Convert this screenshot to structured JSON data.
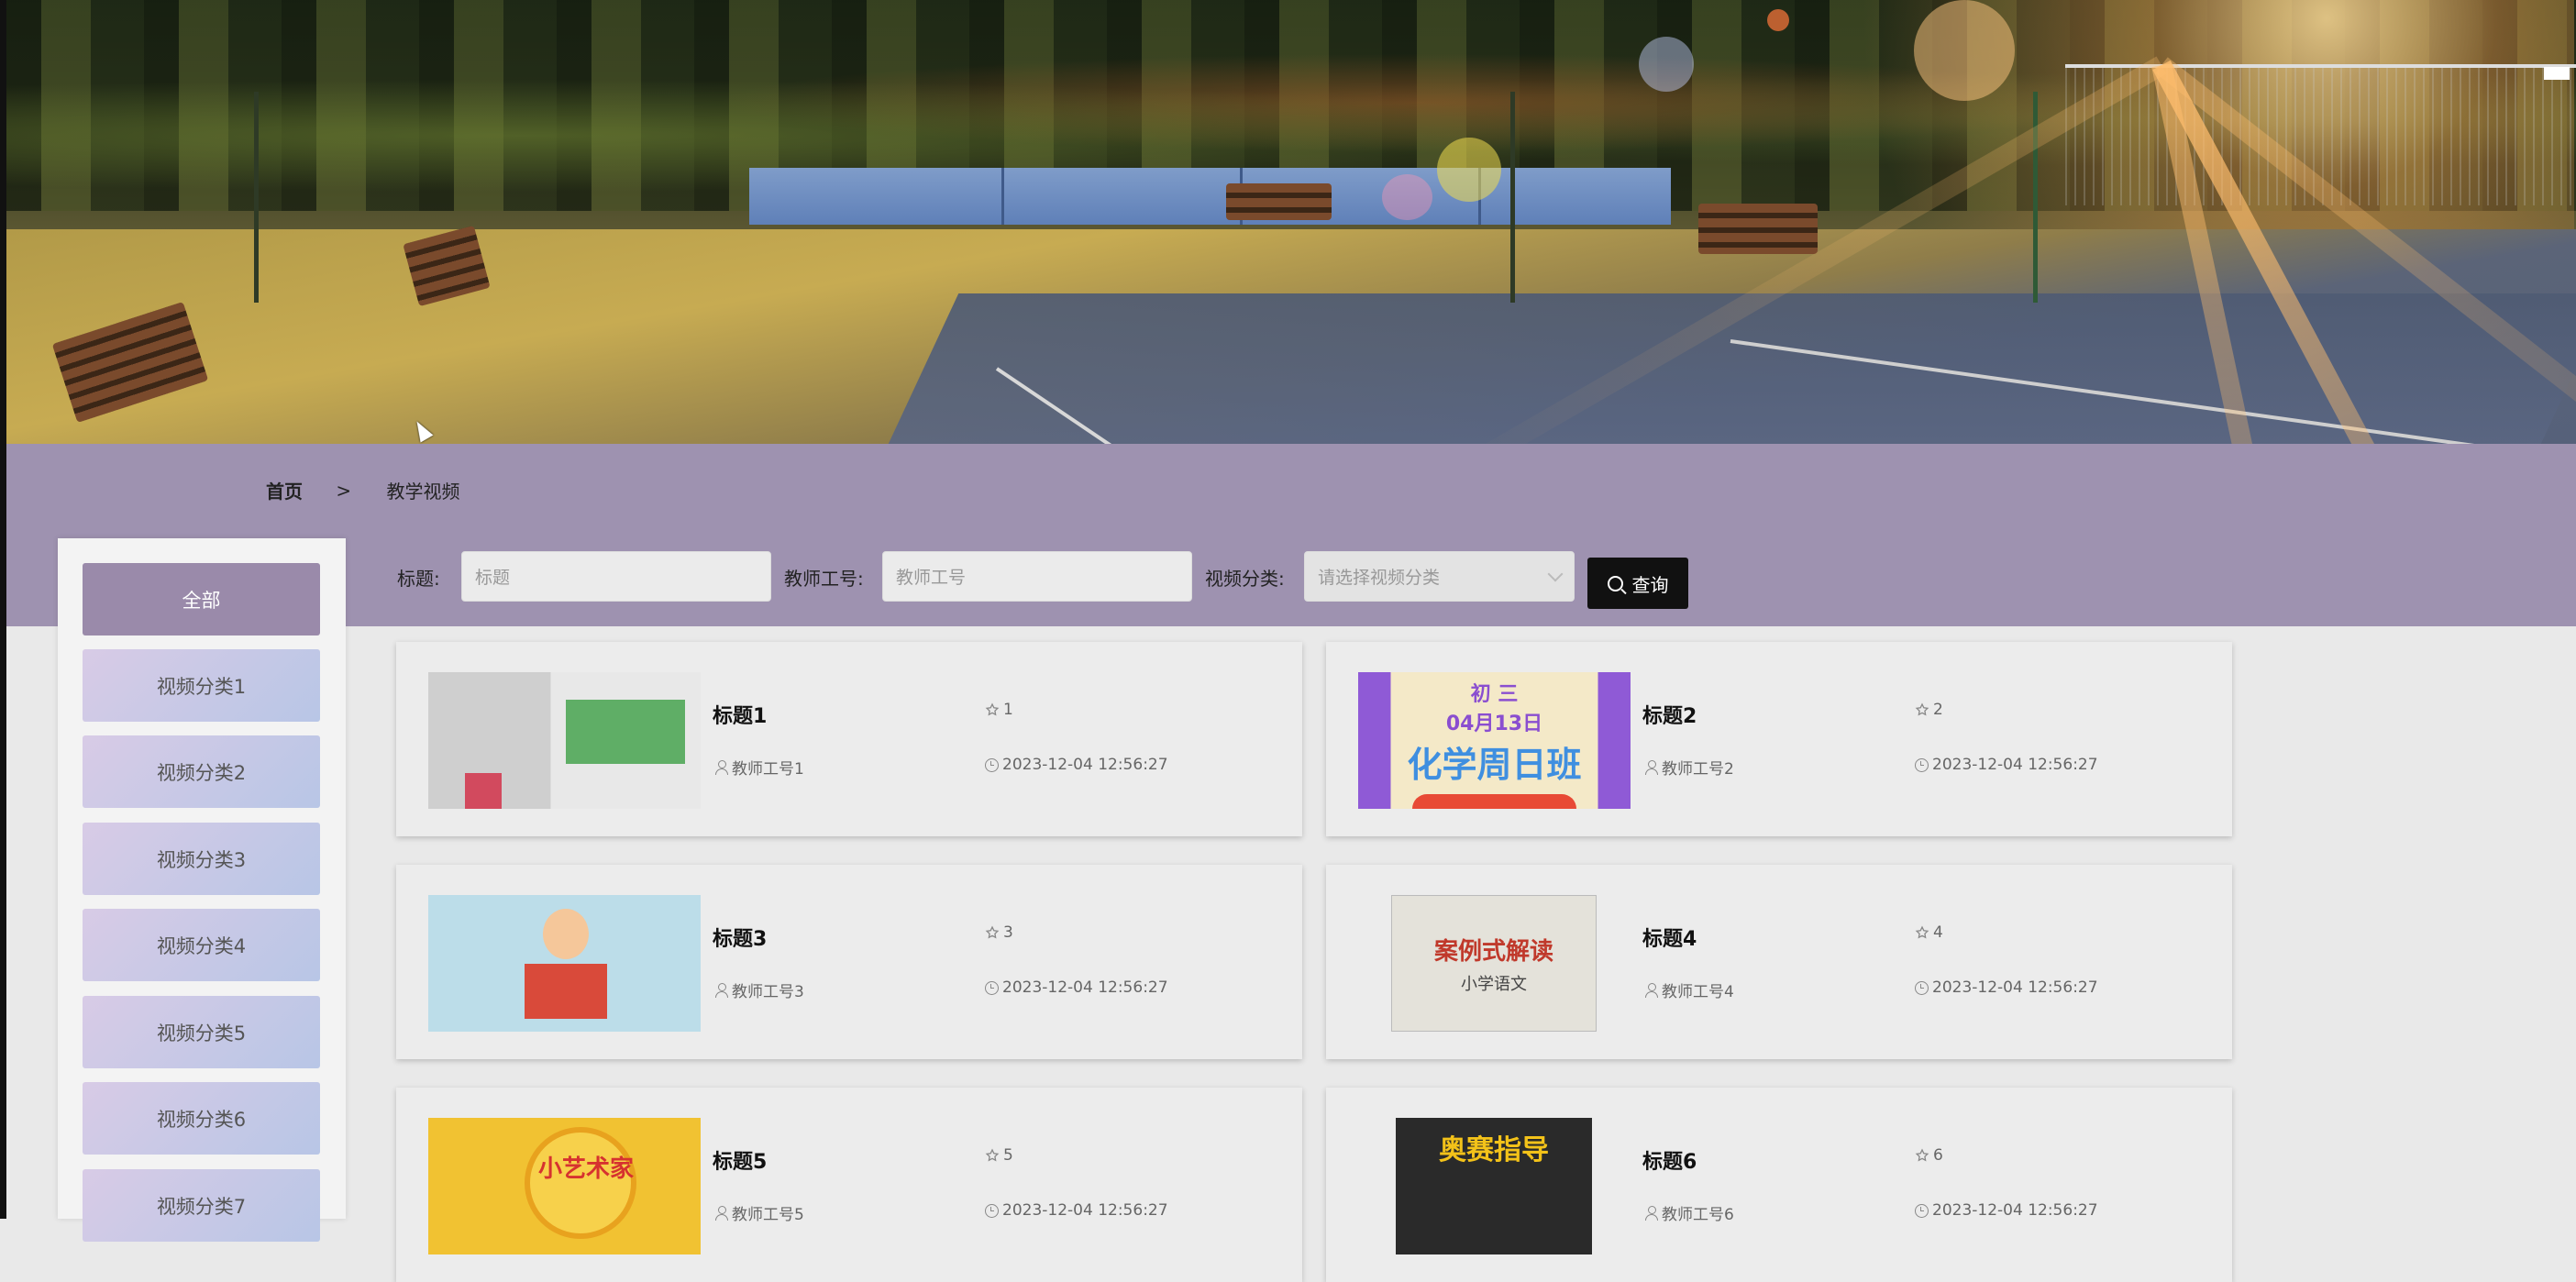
{
  "breadcrumb": {
    "home": "首页",
    "separator": ">",
    "current": "教学视频"
  },
  "sidebar": {
    "items": [
      {
        "label": "全部",
        "active": true
      },
      {
        "label": "视频分类1"
      },
      {
        "label": "视频分类2"
      },
      {
        "label": "视频分类3"
      },
      {
        "label": "视频分类4"
      },
      {
        "label": "视频分类5"
      },
      {
        "label": "视频分类6"
      },
      {
        "label": "视频分类7"
      }
    ]
  },
  "search": {
    "title_label": "标题:",
    "title_placeholder": "标题",
    "teacher_label": "教师工号:",
    "teacher_placeholder": "教师工号",
    "category_label": "视频分类:",
    "category_placeholder": "请选择视频分类",
    "button_label": "查询"
  },
  "cards": [
    {
      "title": "标题1",
      "favorites": "1",
      "teacher": "教师工号1",
      "time": "2023-12-04 12:56:27",
      "thumb": "book-cover-icon"
    },
    {
      "title": "标题2",
      "favorites": "2",
      "teacher": "教师工号2",
      "time": "2023-12-04 12:56:27",
      "thumb": "poster-icon",
      "thumb_text_top": "初 三",
      "thumb_text_date": "04月13日",
      "thumb_text_main": "化学周日班"
    },
    {
      "title": "标题3",
      "favorites": "3",
      "teacher": "教师工号3",
      "time": "2023-12-04 12:56:27",
      "thumb": "cartoon-reader-icon"
    },
    {
      "title": "标题4",
      "favorites": "4",
      "teacher": "教师工号4",
      "time": "2023-12-04 12:56:27",
      "thumb": "book-cover-icon",
      "thumb_text_main": "案例式解读",
      "thumb_text_sub": "小学语文"
    },
    {
      "title": "标题5",
      "favorites": "5",
      "teacher": "教师工号5",
      "time": "2023-12-04 12:56:27",
      "thumb": "art-poster-icon",
      "thumb_text_main": "小艺术家"
    },
    {
      "title": "标题6",
      "favorites": "6",
      "teacher": "教师工号6",
      "time": "2023-12-04 12:56:27",
      "thumb": "book-cover-icon",
      "thumb_text_main": "奥赛指导"
    }
  ],
  "colors": {
    "purple_bar": "#9e92b0",
    "sidebar_active": "#9a8aaa",
    "search_button": "#111111"
  }
}
